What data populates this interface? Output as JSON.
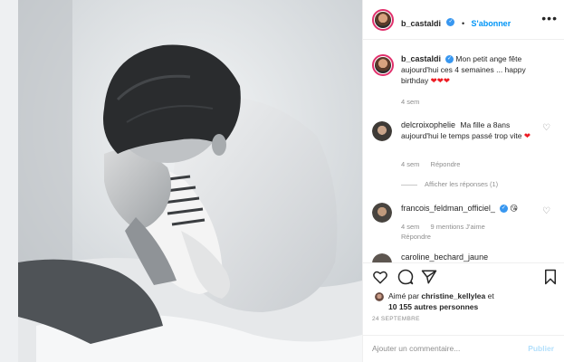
{
  "post": {
    "author": "b_castaldi",
    "follow_label": "S'abonner",
    "separator": "•"
  },
  "caption": {
    "author": "b_castaldi",
    "text": "Mon petit ange fête aujourd'hui ces 4 semaines ... happy birthday",
    "hearts": "❤❤❤",
    "time": "4 sem"
  },
  "comments": [
    {
      "author": "delcroixophelie",
      "text": "Ma fille a 8ans aujourd'hui le temps passé trop vite",
      "emoji": "❤",
      "time": "4 sem",
      "reply_label": "Répondre",
      "view_replies": "Afficher les réponses (1)"
    },
    {
      "author": "francois_feldman_officiel_",
      "emoji": "😘",
      "time": "4 sem",
      "likes": "9 mentions J'aime",
      "reply_label": "Répondre"
    },
    {
      "author": "caroline_bechard_jaune"
    }
  ],
  "likes": {
    "prefix": "Aimé par",
    "user": "christine_kellylea",
    "conj": "et",
    "others": "10 155 autres personnes"
  },
  "date": "24 SEPTEMBRE",
  "add_comment": {
    "placeholder": "Ajouter un commentaire...",
    "publish_label": "Publier"
  },
  "colors": {
    "link_blue": "#0095f6",
    "verified_blue": "#3897f0",
    "heart_red": "#ed1c24",
    "muted": "#8e8e8e",
    "publish_disabled": "#b2dffc"
  }
}
